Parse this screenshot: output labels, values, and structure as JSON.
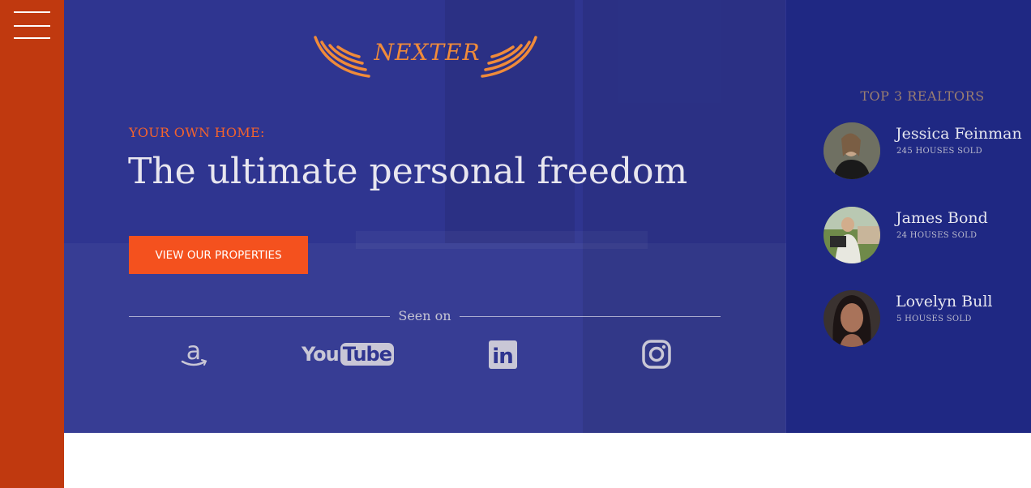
{
  "menu": {
    "icon": "hamburger-menu-icon"
  },
  "logo": {
    "text": "NEXTER",
    "icon": "wings-icon"
  },
  "hero": {
    "kicker": "YOUR OWN HOME:",
    "title": "The ultimate personal freedom",
    "cta_label": "VIEW OUR PROPERTIES"
  },
  "seen_on": {
    "label": "Seen on",
    "brands": [
      {
        "name": "amazon",
        "icon": "amazon-icon"
      },
      {
        "name": "YouTube",
        "you": "You",
        "tube": "Tube",
        "icon": "youtube-icon"
      },
      {
        "name": "linkedin",
        "text": "in",
        "icon": "linkedin-icon"
      },
      {
        "name": "instagram",
        "icon": "instagram-icon"
      }
    ]
  },
  "realtors": {
    "title": "TOP 3 REALTORS",
    "items": [
      {
        "name": "Jessica Feinman",
        "sold": "245 HOUSES SOLD"
      },
      {
        "name": "James Bond",
        "sold": "24 HOUSES SOLD"
      },
      {
        "name": "Lovelyn Bull",
        "sold": "5 HOUSES SOLD"
      }
    ]
  },
  "colors": {
    "sidebar": "#c0390f",
    "hero_bg": "#2f3590",
    "realtors_bg": "#1f2883",
    "accent": "#f4511e",
    "logo": "#f08b3a"
  }
}
